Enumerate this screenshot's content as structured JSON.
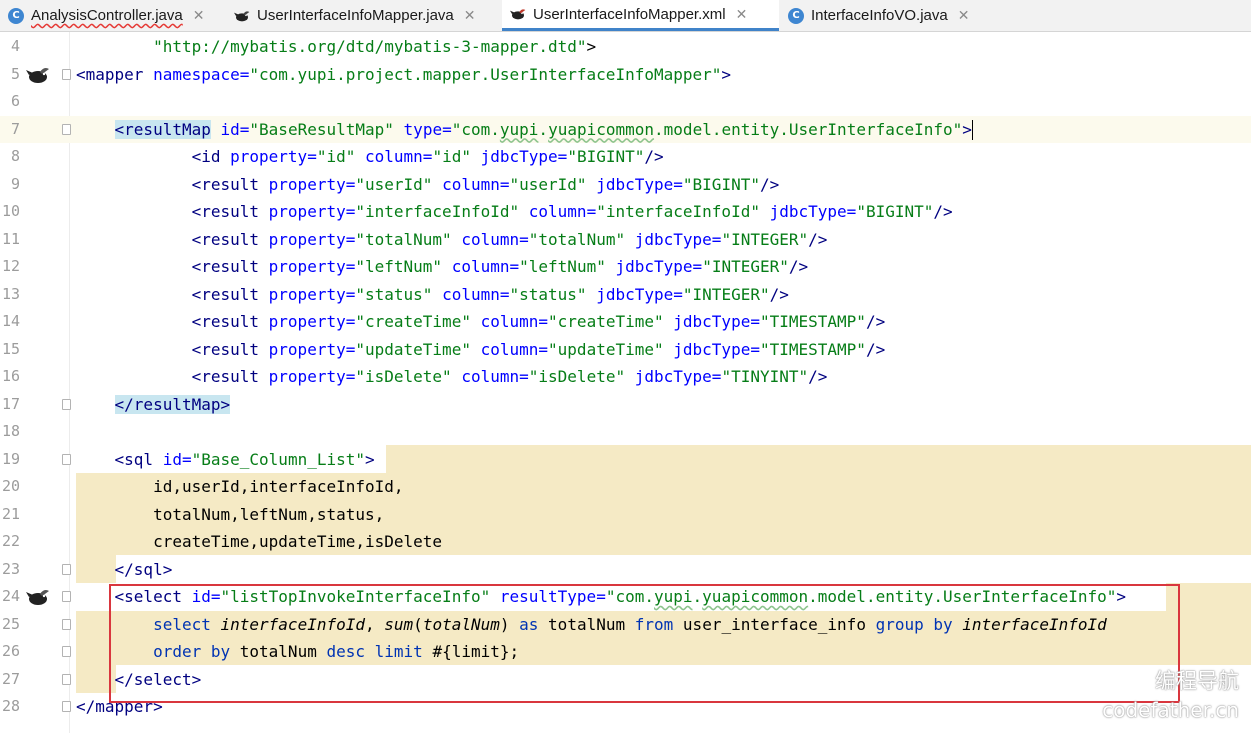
{
  "tabs": [
    {
      "label": "AnalysisController.java",
      "icon": "java-class-icon",
      "error": true,
      "active": false
    },
    {
      "label": "UserInterfaceInfoMapper.java",
      "icon": "mybatis-bird-icon",
      "error": false,
      "active": false
    },
    {
      "label": "UserInterfaceInfoMapper.xml",
      "icon": "mybatis-bird-icon",
      "error": false,
      "active": true
    },
    {
      "label": "InterfaceInfoVO.java",
      "icon": "java-class-icon",
      "error": false,
      "active": false
    }
  ],
  "close_glyph": "✕",
  "lines": [
    {
      "n": "4",
      "parts": [
        {
          "x": "        "
        },
        {
          "s": "\"http://mybatis.org/dtd/mybatis-3-mapper.dtd\""
        },
        {
          "p": ">"
        }
      ]
    },
    {
      "n": "5",
      "parts": [
        {
          "t": "<mapper "
        },
        {
          "a": "namespace="
        },
        {
          "s": "\"com.yupi.project.mapper.UserInterfaceInfoMapper\""
        },
        {
          "t": ">"
        }
      ]
    },
    {
      "n": "6",
      "parts": []
    },
    {
      "n": "7",
      "parts": [
        {
          "x": "    "
        },
        {
          "t": "<resultMap",
          "hl": true
        },
        {
          "t": " "
        },
        {
          "a": "id="
        },
        {
          "s": "\"BaseResultMap\""
        },
        {
          "t": " "
        },
        {
          "a": "type="
        },
        {
          "s": "\"com."
        },
        {
          "s": "yupi",
          "w": true
        },
        {
          "s": "."
        },
        {
          "s": "yuapicommon",
          "w": true
        },
        {
          "s": ".model.entity.UserInterfaceInfo\""
        },
        {
          "t": ">"
        }
      ]
    },
    {
      "n": "8",
      "parts": [
        {
          "x": "            "
        },
        {
          "t": "<id "
        },
        {
          "a": "property="
        },
        {
          "s": "\"id\""
        },
        {
          "t": " "
        },
        {
          "a": "column="
        },
        {
          "s": "\"id\""
        },
        {
          "t": " "
        },
        {
          "a": "jdbcType="
        },
        {
          "s": "\"BIGINT\""
        },
        {
          "t": "/>"
        }
      ]
    },
    {
      "n": "9",
      "parts": [
        {
          "x": "            "
        },
        {
          "t": "<result "
        },
        {
          "a": "property="
        },
        {
          "s": "\"userId\""
        },
        {
          "t": " "
        },
        {
          "a": "column="
        },
        {
          "s": "\"userId\""
        },
        {
          "t": " "
        },
        {
          "a": "jdbcType="
        },
        {
          "s": "\"BIGINT\""
        },
        {
          "t": "/>"
        }
      ]
    },
    {
      "n": "10",
      "parts": [
        {
          "x": "            "
        },
        {
          "t": "<result "
        },
        {
          "a": "property="
        },
        {
          "s": "\"interfaceInfoId\""
        },
        {
          "t": " "
        },
        {
          "a": "column="
        },
        {
          "s": "\"interfaceInfoId\""
        },
        {
          "t": " "
        },
        {
          "a": "jdbcType="
        },
        {
          "s": "\"BIGINT\""
        },
        {
          "t": "/>"
        }
      ]
    },
    {
      "n": "11",
      "parts": [
        {
          "x": "            "
        },
        {
          "t": "<result "
        },
        {
          "a": "property="
        },
        {
          "s": "\"totalNum\""
        },
        {
          "t": " "
        },
        {
          "a": "column="
        },
        {
          "s": "\"totalNum\""
        },
        {
          "t": " "
        },
        {
          "a": "jdbcType="
        },
        {
          "s": "\"INTEGER\""
        },
        {
          "t": "/>"
        }
      ]
    },
    {
      "n": "12",
      "parts": [
        {
          "x": "            "
        },
        {
          "t": "<result "
        },
        {
          "a": "property="
        },
        {
          "s": "\"leftNum\""
        },
        {
          "t": " "
        },
        {
          "a": "column="
        },
        {
          "s": "\"leftNum\""
        },
        {
          "t": " "
        },
        {
          "a": "jdbcType="
        },
        {
          "s": "\"INTEGER\""
        },
        {
          "t": "/>"
        }
      ]
    },
    {
      "n": "13",
      "parts": [
        {
          "x": "            "
        },
        {
          "t": "<result "
        },
        {
          "a": "property="
        },
        {
          "s": "\"status\""
        },
        {
          "t": " "
        },
        {
          "a": "column="
        },
        {
          "s": "\"status\""
        },
        {
          "t": " "
        },
        {
          "a": "jdbcType="
        },
        {
          "s": "\"INTEGER\""
        },
        {
          "t": "/>"
        }
      ]
    },
    {
      "n": "14",
      "parts": [
        {
          "x": "            "
        },
        {
          "t": "<result "
        },
        {
          "a": "property="
        },
        {
          "s": "\"createTime\""
        },
        {
          "t": " "
        },
        {
          "a": "column="
        },
        {
          "s": "\"createTime\""
        },
        {
          "t": " "
        },
        {
          "a": "jdbcType="
        },
        {
          "s": "\"TIMESTAMP\""
        },
        {
          "t": "/>"
        }
      ]
    },
    {
      "n": "15",
      "parts": [
        {
          "x": "            "
        },
        {
          "t": "<result "
        },
        {
          "a": "property="
        },
        {
          "s": "\"updateTime\""
        },
        {
          "t": " "
        },
        {
          "a": "column="
        },
        {
          "s": "\"updateTime\""
        },
        {
          "t": " "
        },
        {
          "a": "jdbcType="
        },
        {
          "s": "\"TIMESTAMP\""
        },
        {
          "t": "/>"
        }
      ]
    },
    {
      "n": "16",
      "parts": [
        {
          "x": "            "
        },
        {
          "t": "<result "
        },
        {
          "a": "property="
        },
        {
          "s": "\"isDelete\""
        },
        {
          "t": " "
        },
        {
          "a": "column="
        },
        {
          "s": "\"isDelete\""
        },
        {
          "t": " "
        },
        {
          "a": "jdbcType="
        },
        {
          "s": "\"TINYINT\""
        },
        {
          "t": "/>"
        }
      ]
    },
    {
      "n": "17",
      "parts": [
        {
          "x": "    "
        },
        {
          "t": "</resultMap>",
          "hl": true
        }
      ]
    },
    {
      "n": "18",
      "parts": []
    },
    {
      "n": "19",
      "parts": [
        {
          "x": "    "
        },
        {
          "t": "<sql "
        },
        {
          "a": "id="
        },
        {
          "s": "\"Base_Column_List\""
        },
        {
          "t": ">"
        }
      ]
    },
    {
      "n": "20",
      "parts": [
        {
          "x": "        "
        },
        {
          "p": "id,userId,interfaceInfoId,"
        }
      ]
    },
    {
      "n": "21",
      "parts": [
        {
          "x": "        "
        },
        {
          "p": "totalNum,leftNum,status,"
        }
      ]
    },
    {
      "n": "22",
      "parts": [
        {
          "x": "        "
        },
        {
          "p": "createTime,updateTime,isDelete"
        }
      ]
    },
    {
      "n": "23",
      "parts": [
        {
          "x": "    "
        },
        {
          "t": "</sql>"
        }
      ]
    },
    {
      "n": "24",
      "parts": [
        {
          "x": "    "
        },
        {
          "t": "<select "
        },
        {
          "a": "id="
        },
        {
          "s": "\"listTopInvokeInterfaceInfo\""
        },
        {
          "t": " "
        },
        {
          "a": "resultType="
        },
        {
          "s": "\"com."
        },
        {
          "s": "yupi",
          "w": true
        },
        {
          "s": "."
        },
        {
          "s": "yuapicommon",
          "w": true
        },
        {
          "s": ".model.entity.UserInterfaceInfo\""
        },
        {
          "t": ">"
        }
      ]
    },
    {
      "n": "25",
      "parts": [
        {
          "x": "        "
        },
        {
          "k": "select "
        },
        {
          "i": "interfaceInfoId"
        },
        {
          "p": ", "
        },
        {
          "ki": "sum"
        },
        {
          "p": "("
        },
        {
          "i": "totalNum"
        },
        {
          "p": ") "
        },
        {
          "k": "as "
        },
        {
          "p": "totalNum "
        },
        {
          "k": "from "
        },
        {
          "p": "user_interface_info "
        },
        {
          "k": "group by "
        },
        {
          "i": "interfaceInfoId"
        }
      ]
    },
    {
      "n": "26",
      "parts": [
        {
          "x": "        "
        },
        {
          "k": "order by "
        },
        {
          "p": "totalNum "
        },
        {
          "k": "desc limit "
        },
        {
          "p": "#{limit};"
        }
      ]
    },
    {
      "n": "27",
      "parts": [
        {
          "x": "    "
        },
        {
          "t": "</select>"
        }
      ]
    },
    {
      "n": "28",
      "parts": [
        {
          "t": "</mapper>"
        }
      ]
    }
  ],
  "watermark": {
    "line1": "编程导航",
    "line2": "codefather.cn"
  }
}
